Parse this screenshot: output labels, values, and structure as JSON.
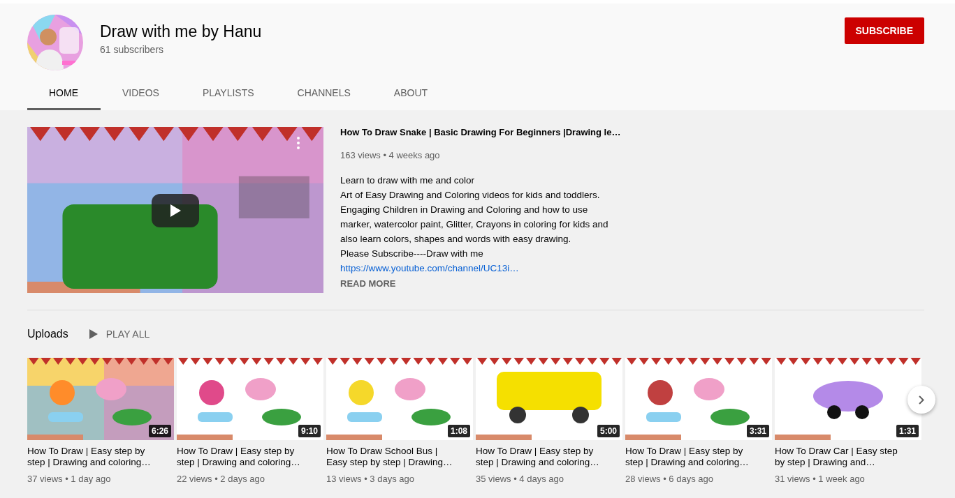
{
  "channel": {
    "name": "Draw with me by Hanu",
    "subscribers": "61 subscribers",
    "subscribe_label": "SUBSCRIBE"
  },
  "tabs": [
    {
      "label": "HOME",
      "selected": true
    },
    {
      "label": "VIDEOS",
      "selected": false
    },
    {
      "label": "PLAYLISTS",
      "selected": false
    },
    {
      "label": "CHANNELS",
      "selected": false
    },
    {
      "label": "ABOUT",
      "selected": false
    }
  ],
  "featured": {
    "title": "How To Draw Snake | Basic Drawing For Beginners |Drawing le…",
    "meta": "163 views • 4 weeks ago",
    "description": [
      "Learn to draw with me and color",
      "Art of Easy Drawing and Coloring videos for kids and toddlers.",
      "Engaging Children in Drawing and Coloring and how to use marker, watercolor paint, Glitter, Crayons in coloring for kids and also learn colors, shapes and words with easy drawing.",
      "Please Subscribe----Draw with me"
    ],
    "link": "https://www.youtube.com/channel/UC13i…",
    "read_more": "READ MORE"
  },
  "uploads": {
    "heading": "Uploads",
    "play_all": "PLAY ALL",
    "videos": [
      {
        "title": "How To Draw | Easy step by step | Drawing and coloring…",
        "meta": "37 views • 1 day ago",
        "duration": "6:26"
      },
      {
        "title": "How To Draw | Easy step by step | Drawing and coloring…",
        "meta": "22 views • 2 days ago",
        "duration": "9:10"
      },
      {
        "title": "How To Draw School Bus | Easy step by step | Drawing…",
        "meta": "13 views • 3 days ago",
        "duration": "1:08"
      },
      {
        "title": "How To Draw | Easy step by step | Drawing and coloring…",
        "meta": "35 views • 4 days ago",
        "duration": "5:00"
      },
      {
        "title": "How To Draw | Easy step by step | Drawing and coloring…",
        "meta": "28 views • 6 days ago",
        "duration": "3:31"
      },
      {
        "title": "How To Draw Car | Easy step by step | Drawing and…",
        "meta": "31 views • 1 week ago",
        "duration": "1:31"
      }
    ]
  }
}
